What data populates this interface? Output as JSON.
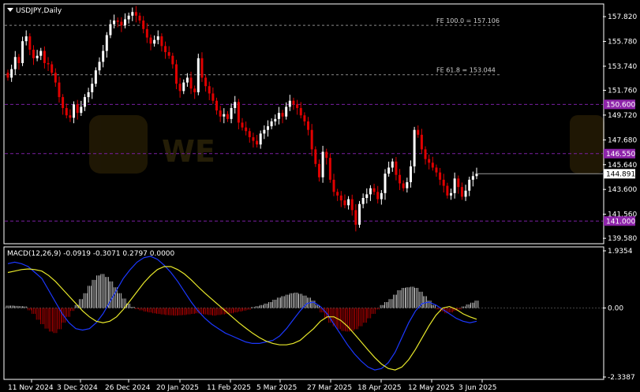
{
  "window": {
    "symbol_label": "USDJPY,Daily"
  },
  "chart_data": [
    {
      "type": "candlestick",
      "title": "USDJPY,Daily",
      "ylim": [
        139.2,
        158.8
      ],
      "price_ticks": [
        "157.820",
        "155.780",
        "153.740",
        "151.760",
        "149.720",
        "147.680",
        "145.640",
        "143.600",
        "141.560",
        "139.580"
      ],
      "x_ticks": [
        "11 Nov 2024",
        "3 Dec 2024",
        "26 Dec 2024",
        "20 Jan 2025",
        "11 Feb 2025",
        "5 Mar 2025",
        "27 Mar 2025",
        "18 Apr 2025",
        "12 May 2025",
        "3 Jun 2025"
      ],
      "fibonacci": [
        {
          "label": "FE 100.0 = 157.106",
          "value": 157.106
        },
        {
          "label": "FE 61.8 = 153.044",
          "value": 153.044
        }
      ],
      "levels": [
        {
          "label": "150.600",
          "value": 150.6
        },
        {
          "label": "146.550",
          "value": 146.55
        },
        {
          "label": "141.000",
          "value": 141.0
        }
      ],
      "current_price": {
        "label": "144.891",
        "value": 144.891
      },
      "closes": [
        152.8,
        153.5,
        154.5,
        154.0,
        155.8,
        156.2,
        155.1,
        154.4,
        154.6,
        155.0,
        154.0,
        153.9,
        153.2,
        152.4,
        151.2,
        150.3,
        149.7,
        149.5,
        150.6,
        149.9,
        150.4,
        151.2,
        151.6,
        152.3,
        153.4,
        154.1,
        155.0,
        156.3,
        157.2,
        157.5,
        157.4,
        157.1,
        157.6,
        157.9,
        158.2,
        157.9,
        157.5,
        156.8,
        156.1,
        155.6,
        155.9,
        156.2,
        155.4,
        154.9,
        154.6,
        153.9,
        152.3,
        151.7,
        152.4,
        152.8,
        151.9,
        151.6,
        154.4,
        152.8,
        152.1,
        151.5,
        150.9,
        150.1,
        149.6,
        149.8,
        149.4,
        150.3,
        150.8,
        149.1,
        148.7,
        148.4,
        147.9,
        147.6,
        147.3,
        148.2,
        148.5,
        148.8,
        149.2,
        149.4,
        149.9,
        149.6,
        150.4,
        150.9,
        150.6,
        150.3,
        149.7,
        149.2,
        148.5,
        146.9,
        145.7,
        144.6,
        146.7,
        146.2,
        144.4,
        143.4,
        143.1,
        142.7,
        142.3,
        142.8,
        141.9,
        140.7,
        142.4,
        142.9,
        143.2,
        143.7,
        143.4,
        142.8,
        143.3,
        144.9,
        145.4,
        145.9,
        144.8,
        144.1,
        143.7,
        144.2,
        145.5,
        148.5,
        148.1,
        146.9,
        146.1,
        145.8,
        145.4,
        145.0,
        144.4,
        143.9,
        143.1,
        143.3,
        144.5,
        143.8,
        143.0,
        143.5,
        144.4,
        144.7,
        144.9
      ],
      "macd": {
        "label": "MACD(12,26,9) -0.0919 -0.3071 0.2797 0.0000",
        "ylim": [
          -2.3387,
          1.9354
        ],
        "ticks": [
          "1.9354",
          "0.00",
          "-2.3387"
        ],
        "histogram": [
          0.08,
          0.08,
          0.07,
          0.06,
          0.05,
          -0.08,
          -0.2,
          -0.4,
          -0.55,
          -0.7,
          -0.8,
          -0.85,
          -0.72,
          -0.5,
          -0.3,
          -0.1,
          0.1,
          0.3,
          0.5,
          0.75,
          0.95,
          1.1,
          1.15,
          1.05,
          0.9,
          0.7,
          0.5,
          0.32,
          0.15,
          0.04,
          -0.04,
          -0.08,
          -0.12,
          -0.15,
          -0.18,
          -0.2,
          -0.22,
          -0.24,
          -0.25,
          -0.26,
          -0.25,
          -0.24,
          -0.22,
          -0.2,
          -0.18,
          -0.2,
          -0.22,
          -0.24,
          -0.26,
          -0.24,
          -0.22,
          -0.2,
          -0.18,
          -0.15,
          -0.12,
          -0.09,
          -0.06,
          0.03,
          0.06,
          0.1,
          0.15,
          0.2,
          0.28,
          0.35,
          0.4,
          0.45,
          0.5,
          0.52,
          0.48,
          0.42,
          0.35,
          0.25,
          0.1,
          -0.15,
          -0.35,
          -0.5,
          -0.62,
          -0.72,
          -0.78,
          -0.8,
          -0.78,
          -0.72,
          -0.62,
          -0.5,
          -0.35,
          -0.2,
          -0.05,
          0.1,
          0.2,
          0.3,
          0.45,
          0.6,
          0.68,
          0.7,
          0.72,
          0.68,
          0.55,
          0.4,
          0.25,
          0.1,
          -0.05,
          -0.12,
          -0.18,
          -0.15,
          -0.1,
          -0.05,
          0.05,
          0.12,
          0.18,
          0.25
        ],
        "main_line": [
          1.5,
          1.55,
          1.5,
          1.4,
          1.2,
          1.0,
          0.6,
          0.2,
          -0.2,
          -0.5,
          -0.7,
          -0.75,
          -0.7,
          -0.5,
          -0.2,
          0.2,
          0.6,
          1.0,
          1.3,
          1.55,
          1.7,
          1.75,
          1.65,
          1.45,
          1.2,
          0.9,
          0.55,
          0.2,
          -0.1,
          -0.35,
          -0.55,
          -0.7,
          -0.85,
          -0.95,
          -1.05,
          -1.15,
          -1.2,
          -1.2,
          -1.15,
          -1.1,
          -0.95,
          -0.7,
          -0.4,
          -0.1,
          0.15,
          0.2,
          0.05,
          -0.2,
          -0.55,
          -0.9,
          -1.25,
          -1.55,
          -1.8,
          -2.0,
          -2.1,
          -2.05,
          -1.85,
          -1.5,
          -1.0,
          -0.5,
          -0.1,
          0.15,
          0.2,
          0.1,
          -0.05,
          -0.2,
          -0.35,
          -0.45,
          -0.5,
          -0.45
        ],
        "signal_line": [
          1.2,
          1.25,
          1.3,
          1.32,
          1.3,
          1.25,
          1.1,
          0.9,
          0.65,
          0.4,
          0.15,
          -0.1,
          -0.3,
          -0.45,
          -0.5,
          -0.45,
          -0.3,
          -0.05,
          0.25,
          0.55,
          0.85,
          1.1,
          1.3,
          1.4,
          1.4,
          1.3,
          1.15,
          0.95,
          0.72,
          0.5,
          0.3,
          0.1,
          -0.1,
          -0.3,
          -0.5,
          -0.68,
          -0.85,
          -1.0,
          -1.12,
          -1.2,
          -1.25,
          -1.25,
          -1.2,
          -1.1,
          -0.9,
          -0.7,
          -0.45,
          -0.3,
          -0.3,
          -0.42,
          -0.62,
          -0.88,
          -1.15,
          -1.42,
          -1.68,
          -1.9,
          -2.05,
          -2.1,
          -2.0,
          -1.75,
          -1.4,
          -1.0,
          -0.6,
          -0.25,
          0.0,
          0.05,
          -0.05,
          -0.2,
          -0.3,
          -0.38
        ]
      }
    }
  ],
  "colors": {
    "background": "#000000",
    "grid_dash": "#7a1fa2",
    "fib_dash": "#8a8a8a",
    "bull": "#ffffff",
    "bear": "#e00000",
    "level_label_bg": "#8e24aa",
    "macd_main": "#1c38ff",
    "macd_signal": "#e8e82a",
    "axis": "#ffffff"
  }
}
